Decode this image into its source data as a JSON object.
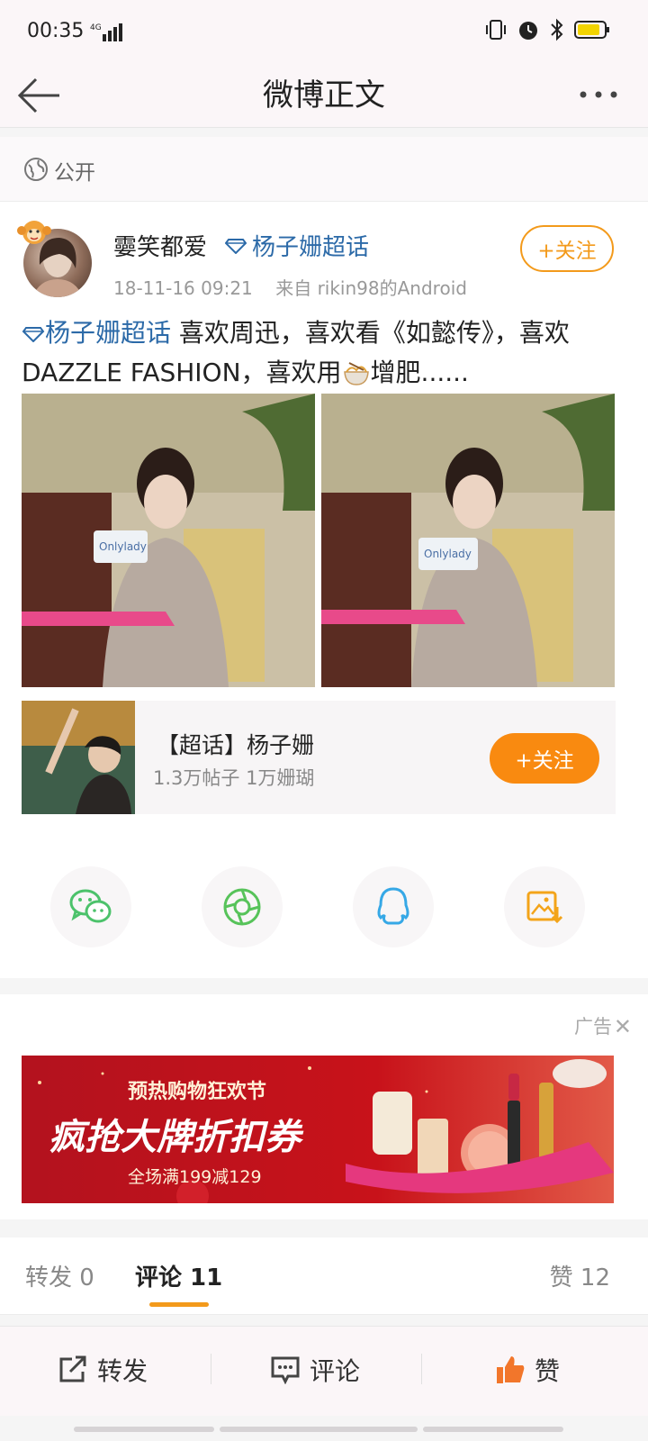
{
  "status_bar": {
    "time": "00:35",
    "network": "4G"
  },
  "header": {
    "title": "微博正文"
  },
  "visibility": {
    "label": "公开"
  },
  "post": {
    "username": "孁笑都爱",
    "tag": "杨子姗超话",
    "timestamp": "18-11-16 09:21",
    "source": "来自 rikin98的Android",
    "follow_label": "+关注",
    "topic_link": "杨子姗超话",
    "text_part1": " 喜欢周迅，喜欢看《如懿传》，喜欢DAZZLE FASHION，喜欢用",
    "text_part2": "增肥......",
    "images": [
      {
        "caption": "Onlylady"
      },
      {
        "caption": "Onlylady"
      }
    ]
  },
  "topic_card": {
    "name": "【超话】杨子姗",
    "stats": "1.3万帖子 1万姗瑚",
    "follow_label": "+关注"
  },
  "share_icons": [
    "wechat-icon",
    "moments-icon",
    "qq-icon",
    "save-image-icon"
  ],
  "ad": {
    "label": "广告",
    "line1": "预热购物狂欢节",
    "line2": "疯抢大牌折扣券",
    "line3": "全场满199减129"
  },
  "tabs": {
    "repost": "转发 0",
    "comment": "评论 11",
    "like": "赞 12"
  },
  "bottom_bar": {
    "repost": "转发",
    "comment": "评论",
    "like": "赞"
  },
  "colors": {
    "accent": "#f39a1b",
    "link": "#2c6aa8",
    "follow_fill": "#f98a10"
  }
}
